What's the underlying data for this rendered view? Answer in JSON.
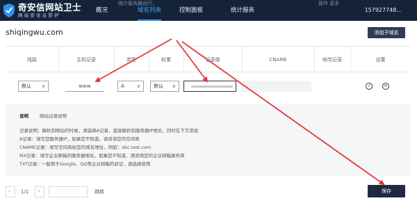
{
  "topbar": {
    "logo_title": "奇安信网站卫士",
    "logo_subtitle": "网站安全云防护",
    "nav": [
      "概况",
      "域名列表",
      "控制面板",
      "统计报表"
    ],
    "user": "157927748...",
    "faded_note": "统计服务器运行，",
    "faded_note2": "操作  更多"
  },
  "domain": {
    "name": "shiqingwu.com",
    "add_button": "添加子域名"
  },
  "table": {
    "headers": [
      "线路",
      "主机记录",
      "类型",
      "权重",
      "记录值",
      "CNAME",
      "修改记录",
      "设置"
    ]
  },
  "edit_row": {
    "line": "默认",
    "host": "www",
    "type": "A",
    "weight": "默认"
  },
  "help": {
    "tabs": [
      "说明",
      "网站记录说明"
    ],
    "lines": [
      "记录说明：解析到网站的时候，请选择A记录，直接解析到服务器IP地址，同时在下方添加",
      "A记录：填写您服务器IP，如果您不知道，请咨询您的空间商",
      "CNAME记录：填写空间商给您的域名地址，例如：abc.test.com",
      "MX记录：填写企业邮箱的服务器地址，如果您不知道，请咨询您的企业邮箱服务商",
      "TXT记录：一般用于Google、QQ等企业邮箱的验证，请选择使用"
    ]
  },
  "footer": {
    "page": "1/1",
    "go_button": "跳转",
    "save_button": "保存"
  },
  "colors": {
    "topbar": "#15233a",
    "accent": "#2e8ff0",
    "button_dark": "#1e2a3d",
    "annotation_red": "#e03a3a"
  }
}
